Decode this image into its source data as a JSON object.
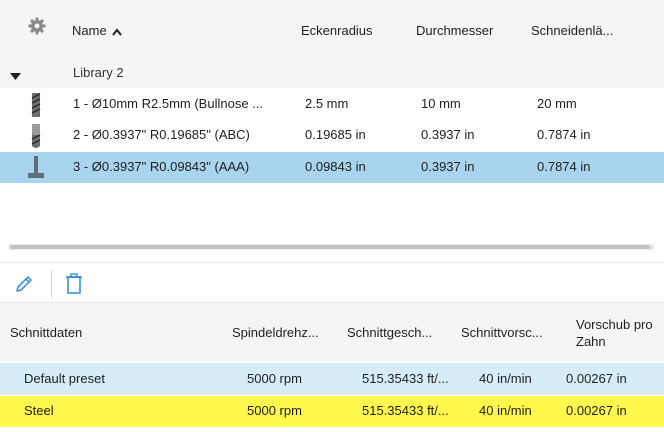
{
  "tool_table": {
    "columns": [
      "Name",
      "Eckenradius",
      "Durchmesser",
      "Schneidenlä..."
    ],
    "group_label": "Library 2",
    "rows": [
      {
        "name": "1 - Ø10mm R2.5mm (Bullnose ...",
        "corner_radius": "2.5 mm",
        "diameter": "10 mm",
        "cutting_length": "20 mm",
        "icon": "bullnose-mill-icon"
      },
      {
        "name": "2 - Ø0.3937\" R0.19685\" (ABC)",
        "corner_radius": "0.19685 in",
        "diameter": "0.3937 in",
        "cutting_length": "0.7874 in",
        "icon": "ball-mill-icon"
      },
      {
        "name": "3 - Ø0.3937\" R0.09843\" (AAA)",
        "corner_radius": "0.09843 in",
        "diameter": "0.3937 in",
        "cutting_length": "0.7874 in",
        "icon": "slot-mill-icon"
      }
    ]
  },
  "cutting_data": {
    "columns": [
      "Schnittdaten",
      "Spindeldrehz...",
      "Schnittgesch...",
      "Schnittvorsc...",
      "Vorschub pro",
      "Zahn"
    ],
    "rows": [
      {
        "name": "Default preset",
        "spindle": "5000 rpm",
        "speed": "515.35433 ft/...",
        "feed": "40 in/min",
        "feed_per_tooth": "0.00267 in"
      },
      {
        "name": "Steel",
        "spindle": "5000 rpm",
        "speed": "515.35433 ft/...",
        "feed": "40 in/min",
        "feed_per_tooth": "0.00267 in"
      }
    ]
  },
  "colors": {
    "selected_row": "#a8d4ee",
    "preset_row": "#d6ecf8",
    "highlight_row": "#fff94d",
    "accent_icon": "#2e8ad8"
  }
}
